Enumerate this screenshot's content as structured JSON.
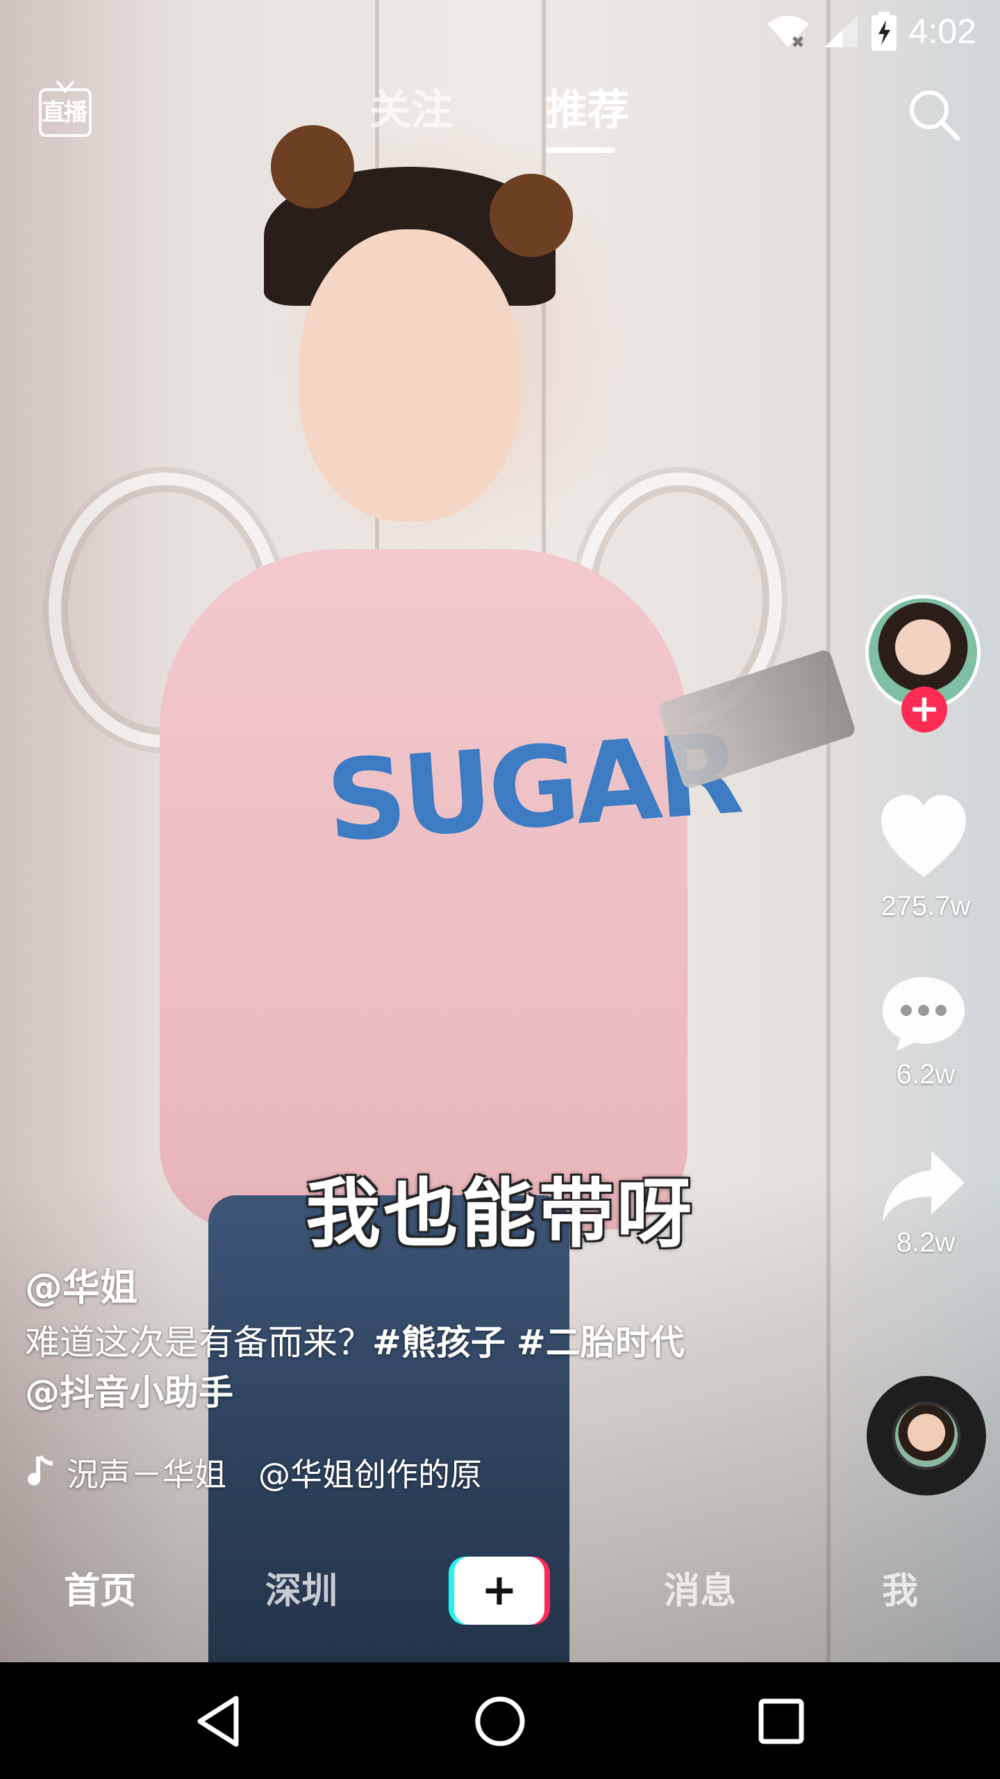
{
  "status_bar": {
    "time": "4:02"
  },
  "top_nav": {
    "live_label": "直播",
    "tabs": [
      {
        "label": "关注",
        "active": false
      },
      {
        "label": "推荐",
        "active": true
      }
    ]
  },
  "video": {
    "subtitle": "我也能带呀",
    "shirt_text": "SUGAR"
  },
  "post": {
    "author": "@华姐",
    "description_text": "难道这次是有备而来？",
    "hashtags": [
      "#熊孩子",
      "#二胎时代"
    ],
    "mention": "@抖音小助手",
    "music": "𝄽声－华姐　@华姐创作的原"
  },
  "music_display": "況声－华姐　@华姐创作的原",
  "actions": {
    "likes": "275.7w",
    "comments": "6.2w",
    "shares": "8.2w"
  },
  "bottom_tabs": {
    "home": "首页",
    "city": "深圳",
    "create": "+",
    "messages": "消息",
    "me": "我"
  },
  "colors": {
    "accent": "#fe2c55",
    "create_cyan": "#25f4ee",
    "text": "#ffffff"
  },
  "icons": [
    "wifi-icon",
    "signal-icon",
    "battery-icon",
    "live-icon",
    "search-icon",
    "heart-icon",
    "comment-icon",
    "share-icon",
    "music-note-icon",
    "back-icon",
    "home-icon",
    "recents-icon"
  ]
}
